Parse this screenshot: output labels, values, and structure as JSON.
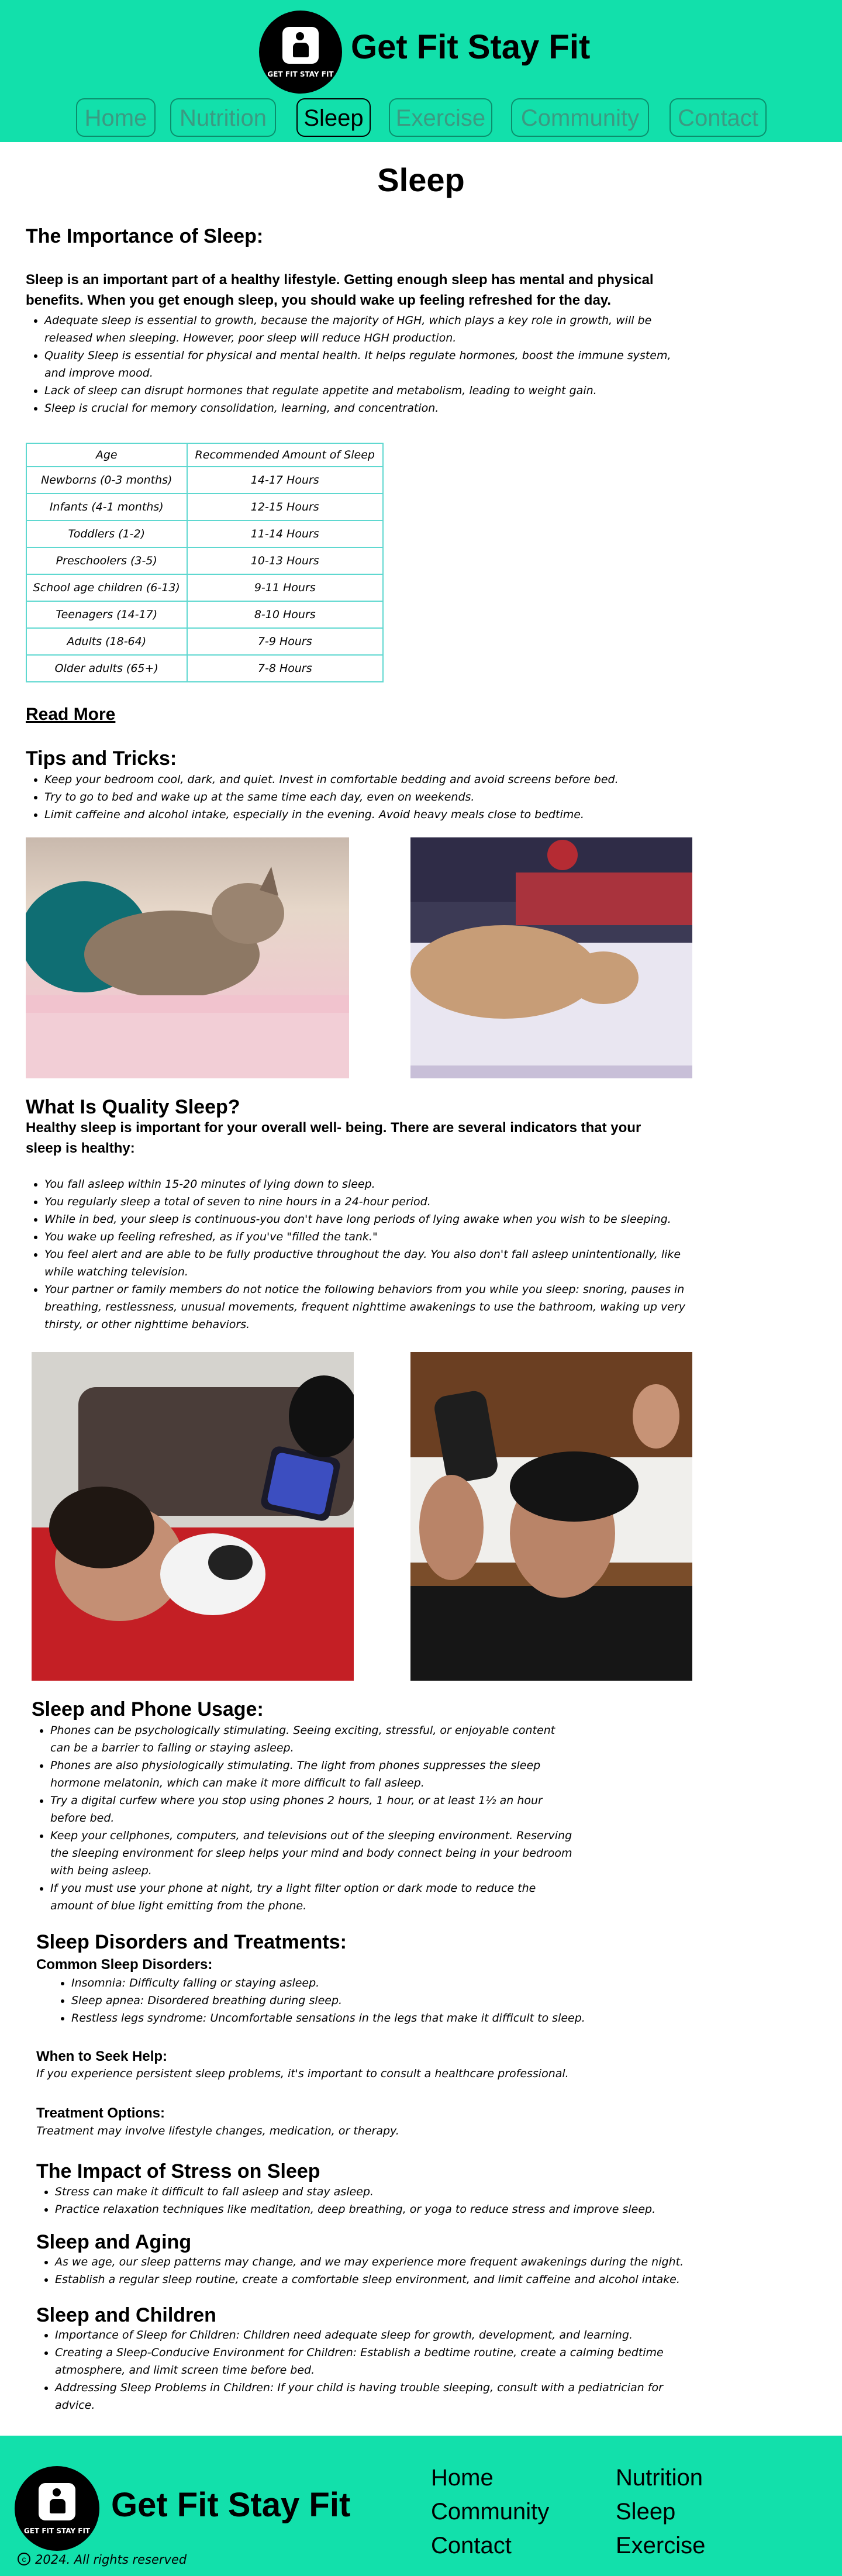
{
  "brand": {
    "name": "Get Fit Stay Fit",
    "logo_text": "GET FIT STAY FIT",
    "accent": "#12e0ab"
  },
  "nav": {
    "items": [
      "Home",
      "Nutrition",
      "Sleep",
      "Exercise",
      "Community",
      "Contact"
    ],
    "active": "Sleep"
  },
  "page": {
    "title": "Sleep"
  },
  "importance": {
    "heading": "The Importance of Sleep:",
    "intro": "Sleep is an important part of a healthy lifestyle. Getting enough sleep has mental and physical benefits. When you get enough sleep, you should wake up feeling refreshed for the day.",
    "bullets": [
      "Adequate sleep is essential to growth, because the majority of HGH, which plays a key role in growth, will be released when sleeping. However, poor sleep will reduce HGH production.",
      "Quality Sleep is essential for physical and mental health. It helps regulate hormones, boost the immune system, and improve mood.",
      " Lack of sleep can disrupt hormones that regulate appetite and metabolism, leading to weight gain.",
      "Sleep is crucial for memory consolidation, learning, and concentration."
    ]
  },
  "table": {
    "headers": [
      "Age",
      "Recommended Amount of Sleep"
    ],
    "rows": [
      [
        "Newborns (0-3 months)",
        "14-17 Hours"
      ],
      [
        "Infants (4-1 months)",
        "12-15 Hours"
      ],
      [
        "Toddlers (1-2)",
        "11-14 Hours"
      ],
      [
        "Preschoolers (3-5)",
        "10-13 Hours"
      ],
      [
        "School age children (6-13)",
        "9-11 Hours"
      ],
      [
        "Teenagers (14-17)",
        "8-10 Hours"
      ],
      [
        "Adults (18-64)",
        "7-9 Hours"
      ],
      [
        "Older adults (65+)",
        "7-8 Hours"
      ]
    ]
  },
  "read_more": "Read More",
  "tips": {
    "heading": "Tips and Tricks:",
    "bullets": [
      "Keep your bedroom cool, dark, and quiet. Invest in comfortable bedding and avoid screens before bed.",
      "Try to go to bed and wake up at the same time each day, even on weekends.",
      "Limit caffeine and alcohol intake, especially in the evening. Avoid heavy meals close to bedtime."
    ]
  },
  "quality": {
    "heading": "What Is Quality Sleep?",
    "intro": "Healthy sleep is important for your overall well- being. There are several indicators that your sleep is healthy:",
    "bullets": [
      "You fall asleep within 15-20 minutes of lying down to sleep.",
      "You regularly sleep a total of seven to nine hours in a 24-hour period.",
      "While in bed, your sleep is continuous-you don't have long periods of lying awake when you wish to be sleeping.",
      "You wake up feeling refreshed, as if you've \"filled the tank.\"",
      "You feel alert and are able to be fully productive throughout the day. You also don't fall asleep unintentionally, like while watching television.",
      "Your partner or family members do not notice the following behaviors from you while you sleep: snoring, pauses in breathing, restlessness, unusual movements, frequent nighttime awakenings to use the bathroom, waking up very thirsty, or other nighttime behaviors."
    ]
  },
  "phone": {
    "heading": "Sleep and Phone Usage:",
    "bullets": [
      "Phones can be psychologically stimulating. Seeing exciting, stressful, or enjoyable content can be a barrier to falling or staying asleep.",
      "Phones are also physiologically stimulating. The light from phones suppresses the sleep hormone melatonin, which can make it more difficult to fall asleep.",
      "Try a digital curfew where you stop using phones 2 hours, 1 hour, or at least 1½ an hour before bed.",
      "Keep your cellphones, computers, and televisions out of the sleeping environment. Reserving the sleeping environment for sleep helps your mind and body connect being in your bedroom with being asleep.",
      "If you must use your phone at night, try a light filter option or dark mode to reduce the amount of blue light emitting from the phone."
    ]
  },
  "disorders": {
    "heading": "Sleep Disorders and Treatments:",
    "common_heading": "Common Sleep Disorders:",
    "common": [
      "Insomnia: Difficulty falling or staying asleep.",
      "Sleep apnea: Disordered breathing during sleep.",
      "Restless legs syndrome: Uncomfortable sensations in the legs that make it difficult to sleep."
    ],
    "seek_heading": "When to Seek Help:",
    "seek_text": "If you experience persistent sleep problems, it's important to consult a healthcare professional.",
    "treat_heading": "Treatment Options:",
    "treat_text": "Treatment may involve lifestyle changes, medication, or therapy."
  },
  "stress": {
    "heading": "The Impact of Stress on Sleep",
    "bullets": [
      "Stress can make it difficult to fall asleep and stay asleep.",
      "Practice relaxation techniques like meditation, deep breathing, or yoga to reduce stress and improve sleep."
    ]
  },
  "aging": {
    "heading": "Sleep and Aging",
    "bullets": [
      "As we age, our sleep patterns may change, and we may experience more frequent awakenings during the night.",
      " Establish a regular sleep routine, create a comfortable sleep environment, and limit caffeine and alcohol intake."
    ]
  },
  "children": {
    "heading": "Sleep and Children",
    "bullets": [
      "Importance of Sleep for Children: Children need adequate sleep for growth, development, and learning.",
      "Creating a Sleep-Conducive Environment for Children: Establish a bedtime routine, create a calming bedtime atmosphere, and limit screen time before bed.",
      "Addressing Sleep Problems in Children: If your child is having trouble sleeping, consult with a pediatrician for advice."
    ]
  },
  "footer": {
    "links": [
      "Home",
      "Nutrition",
      "Community",
      "Sleep",
      "Contact",
      "Exercise"
    ],
    "copyright": "2024. All rights reserved",
    "copyright_symbol": "c"
  }
}
